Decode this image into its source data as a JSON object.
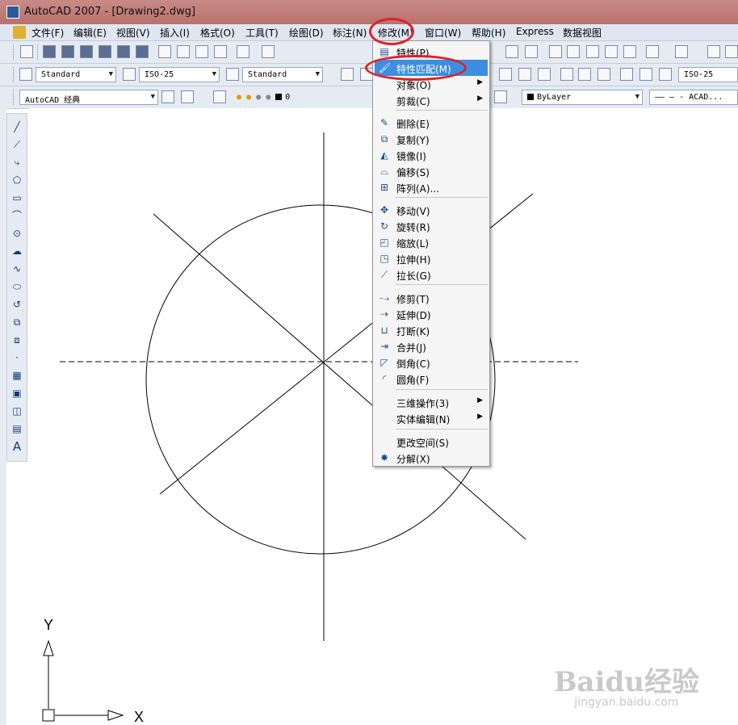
{
  "window": {
    "title": "AutoCAD 2007 - [Drawing2.dwg]"
  },
  "menubar": {
    "items": [
      "文件(F)",
      "编辑(E)",
      "视图(V)",
      "插入(I)",
      "格式(O)",
      "工具(T)",
      "绘图(D)",
      "标注(N)",
      "修改(M)",
      "窗口(W)",
      "帮助(H)",
      "Express",
      "数据视图"
    ]
  },
  "toolbar2": {
    "text_style": "Standard",
    "dim_style": "ISO-25",
    "table_style": "Standard",
    "dim_style_right": "ISO-25"
  },
  "toolbar3": {
    "workspace": "AutoCAD 经典",
    "layer": "0",
    "color": "ByLayer",
    "linetype": "ACAD..."
  },
  "modify_menu": {
    "items": [
      {
        "label": "特性(P)",
        "icon": "properties-icon"
      },
      {
        "label": "特性匹配(M)",
        "icon": "match-properties-icon"
      },
      {
        "label": "对象(O)",
        "icon": ""
      },
      {
        "label": "剪裁(C)",
        "icon": ""
      },
      {
        "label": "删除(E)",
        "icon": "erase-icon"
      },
      {
        "label": "复制(Y)",
        "icon": "copy-icon"
      },
      {
        "label": "镜像(I)",
        "icon": "mirror-icon"
      },
      {
        "label": "偏移(S)",
        "icon": "offset-icon"
      },
      {
        "label": "阵列(A)...",
        "icon": "array-icon"
      },
      {
        "label": "移动(V)",
        "icon": "move-icon"
      },
      {
        "label": "旋转(R)",
        "icon": "rotate-icon"
      },
      {
        "label": "缩放(L)",
        "icon": "scale-icon"
      },
      {
        "label": "拉伸(H)",
        "icon": "stretch-icon"
      },
      {
        "label": "拉长(G)",
        "icon": "lengthen-icon"
      },
      {
        "label": "修剪(T)",
        "icon": "trim-icon"
      },
      {
        "label": "延伸(D)",
        "icon": "extend-icon"
      },
      {
        "label": "打断(K)",
        "icon": "break-icon"
      },
      {
        "label": "合并(J)",
        "icon": "join-icon"
      },
      {
        "label": "倒角(C)",
        "icon": "chamfer-icon"
      },
      {
        "label": "圆角(F)",
        "icon": "fillet-icon"
      },
      {
        "label": "三维操作(3)",
        "icon": ""
      },
      {
        "label": "实体编辑(N)",
        "icon": ""
      },
      {
        "label": "更改空间(S)",
        "icon": ""
      },
      {
        "label": "分解(X)",
        "icon": "explode-icon"
      }
    ]
  },
  "ucs": {
    "x_label": "X",
    "y_label": "Y"
  },
  "watermark": {
    "brand": "Baidu经验",
    "url": "jingyan.baidu.com"
  },
  "colors": {
    "highlight": "#3d8ee0",
    "annotation": "#e0202a"
  }
}
